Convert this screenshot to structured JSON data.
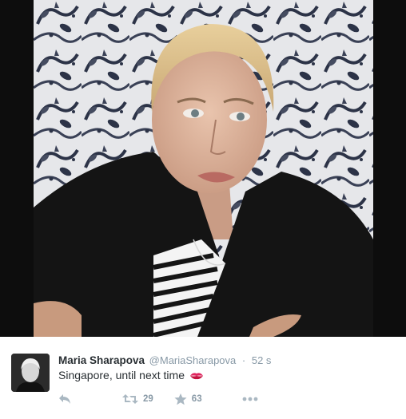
{
  "tweet": {
    "author_name": "Maria Sharapova",
    "author_handle": "@MariaSharapova",
    "separator": "·",
    "timestamp": "52 s",
    "text": "Singapore, until next time",
    "emoji": "kiss-mark-icon"
  },
  "actions": {
    "retweet_count": "29",
    "favorite_count": "63"
  },
  "colors": {
    "muted": "#8899a6",
    "text": "#292f33",
    "kiss": "#e0245e"
  }
}
